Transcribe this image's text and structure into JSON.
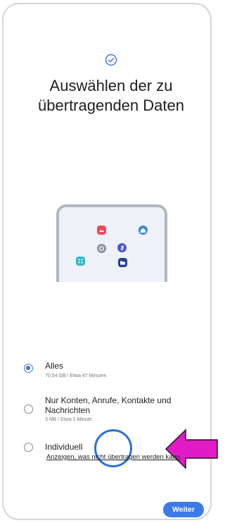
{
  "title": "Auswählen der zu übertragenden Daten",
  "options": [
    {
      "label": "Alles",
      "sub": "70,54 GB / Etwa 47 Minuten",
      "selected": true
    },
    {
      "label": "Nur Konten, Anrufe, Kontakte und Nachrichten",
      "sub": "3 MB / Etwa 1 Minute",
      "selected": false
    },
    {
      "label": "Individuell",
      "sub": "",
      "selected": false
    }
  ],
  "link": "Anzeigen, was nicht übertragen werden kann",
  "button": "Weiter",
  "colors": {
    "accent": "#3b7ae8",
    "arrow": "#e11bc6"
  },
  "icons": {
    "header": "check-circle-icon",
    "annotation": "arrow-left-icon"
  }
}
